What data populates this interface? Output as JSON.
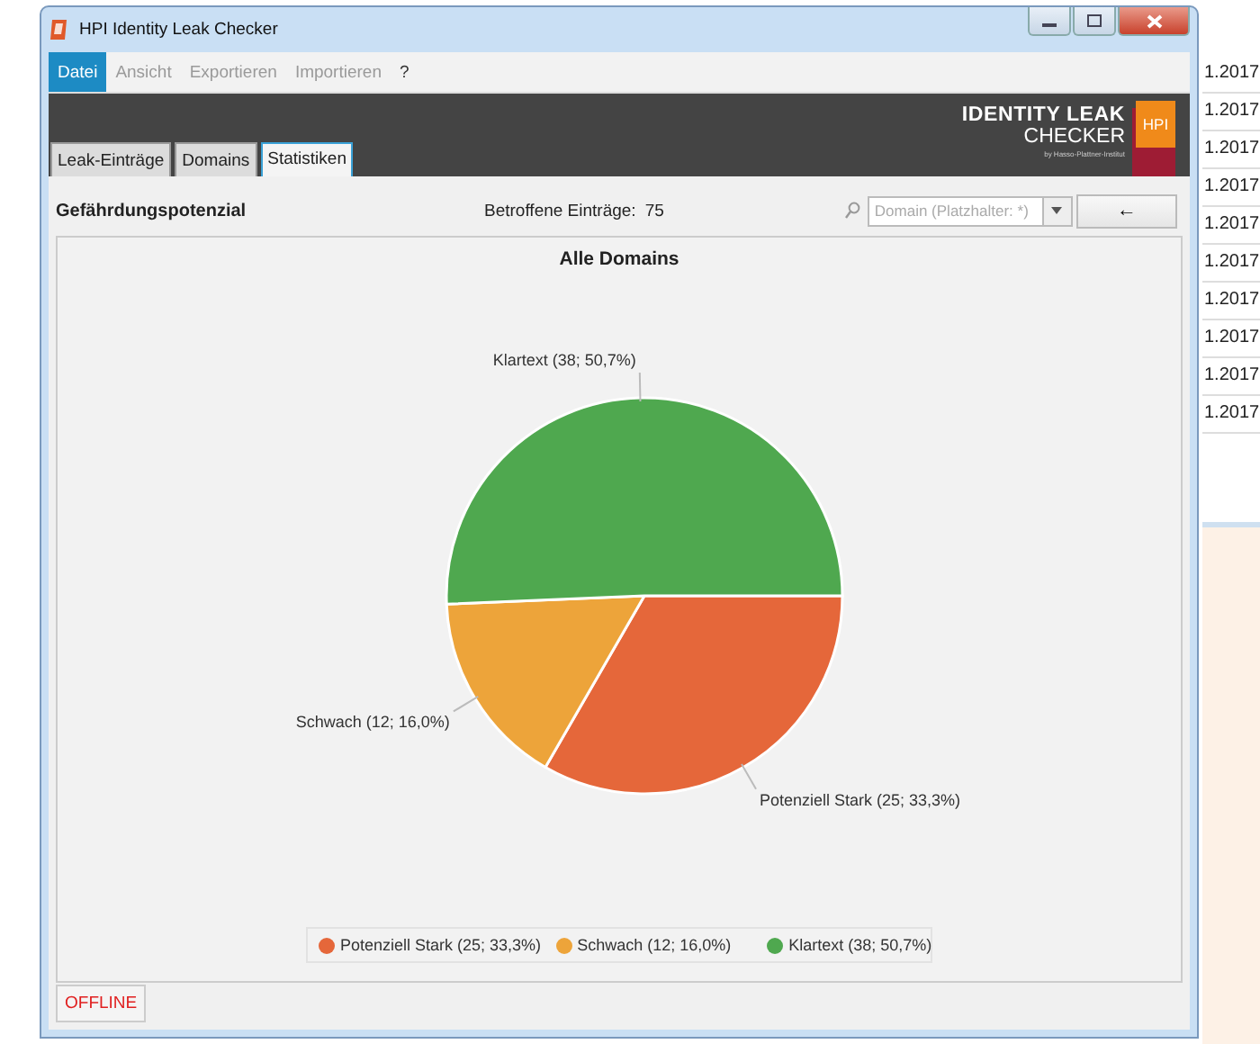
{
  "background_table": {
    "date_column": [
      "1.2017",
      "1.2017",
      "1.2017",
      "1.2017",
      "1.2017",
      "1.2017",
      "1.2017",
      "1.2017",
      "1.2017",
      "1.2017"
    ]
  },
  "window": {
    "title": "HPI Identity Leak Checker"
  },
  "menu": [
    {
      "label": "Datei",
      "selected": true,
      "disabled": false
    },
    {
      "label": "Ansicht",
      "selected": false,
      "disabled": true
    },
    {
      "label": "Exportieren",
      "selected": false,
      "disabled": true
    },
    {
      "label": "Importieren",
      "selected": false,
      "disabled": true
    },
    {
      "label": "?",
      "selected": false,
      "disabled": false
    }
  ],
  "logo": {
    "line_1": "IDENTITY LEAK",
    "line_2": "CHECKER",
    "byline": "by Hasso-Plattner-Institut",
    "badge": "HPI"
  },
  "tabs": [
    {
      "label": "Leak-Einträge",
      "selected": false
    },
    {
      "label": "Domains",
      "selected": false
    },
    {
      "label": "Statistiken",
      "selected": true
    }
  ],
  "toolbar": {
    "title": "Gefährdungspotenzial",
    "count_label": "Betroffene Einträge:",
    "count": "75",
    "domain_placeholder": "Domain (Platzhalter: *)",
    "back_button": "←"
  },
  "chart_data": {
    "type": "pie",
    "title": "Alle Domains",
    "values": [
      25,
      12,
      38
    ],
    "value_labels": [
      "Potenziell Stark (25; 33,3%)",
      "Schwach (12; 16,0%)",
      "Klartext (38; 50,7%)"
    ]
  },
  "legend": [
    {
      "label": "Potenziell Stark (25; 33,3%)",
      "color": "#e5673a"
    },
    {
      "label": "Schwach (12; 16,0%)",
      "color": "#eda43a"
    },
    {
      "label": "Klartext (38; 50,7%)",
      "color": "#4fa84f"
    }
  ],
  "status_button": "OFFLINE"
}
